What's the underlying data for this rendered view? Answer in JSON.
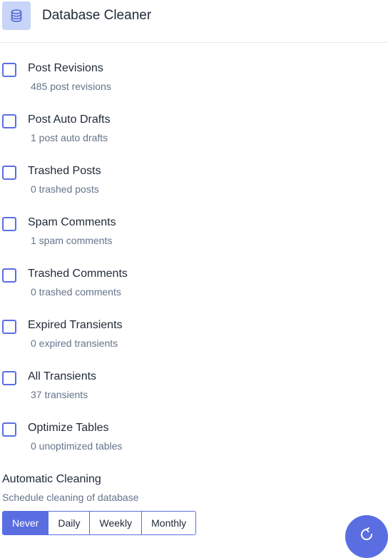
{
  "header": {
    "title": "Database Cleaner",
    "icon": "database-icon"
  },
  "items": [
    {
      "label": "Post Revisions",
      "count": "485 post revisions",
      "checked": false
    },
    {
      "label": "Post Auto Drafts",
      "count": "1 post auto drafts",
      "checked": false
    },
    {
      "label": "Trashed Posts",
      "count": "0 trashed posts",
      "checked": false
    },
    {
      "label": "Spam Comments",
      "count": "1 spam comments",
      "checked": false
    },
    {
      "label": "Trashed Comments",
      "count": "0 trashed comments",
      "checked": false
    },
    {
      "label": "Expired Transients",
      "count": "0 expired transients",
      "checked": false
    },
    {
      "label": "All Transients",
      "count": "37 transients",
      "checked": false
    },
    {
      "label": "Optimize Tables",
      "count": "0 unoptimized tables",
      "checked": false
    }
  ],
  "automatic_cleaning": {
    "title": "Automatic Cleaning",
    "subtitle": "Schedule cleaning of database",
    "options": [
      "Never",
      "Daily",
      "Weekly",
      "Monthly"
    ],
    "selected": "Never"
  },
  "fab": {
    "icon": "refresh-icon"
  },
  "colors": {
    "accent": "#5b6ee1",
    "icon_bg": "#c8d4f8",
    "muted_text": "#64748b"
  }
}
